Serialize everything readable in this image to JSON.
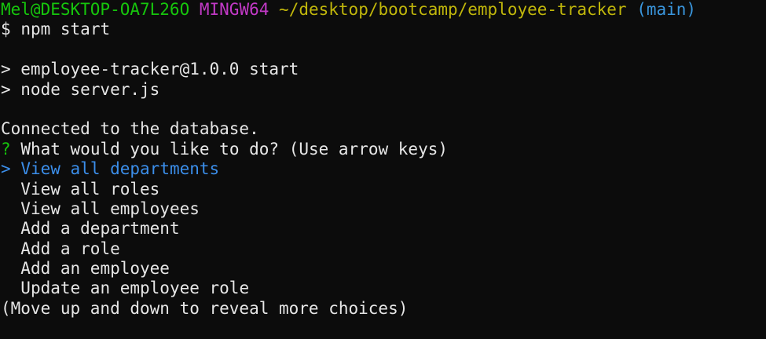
{
  "prompt": {
    "user_host": "Mel@DESKTOP-OA7L26O",
    "env": "MINGW64",
    "path": "~/desktop/bootcamp/employee-tracker",
    "branch": "(main)",
    "symbol": "$",
    "command": "npm start"
  },
  "npm_output": {
    "line1": "> employee-tracker@1.0.0 start",
    "line2": "> node server.js"
  },
  "app_output": {
    "connected": "Connected to the database."
  },
  "question": {
    "marker": "?",
    "text": "What would you like to do?",
    "hint": "(Use arrow keys)"
  },
  "menu": {
    "pointer": ">",
    "selected_index": 0,
    "items": [
      "View all departments",
      "View all roles",
      "View all employees",
      "Add a department",
      "Add a role",
      "Add an employee",
      "Update an employee role"
    ],
    "footer": "(Move up and down to reveal more choices)"
  },
  "colors": {
    "background": "#0c0c0c",
    "user_host": "#16c60c",
    "env": "#c239c6",
    "path": "#c1b70b",
    "branch": "#3a96dd",
    "selected": "#3b8eea",
    "text": "#e6e6e6"
  }
}
